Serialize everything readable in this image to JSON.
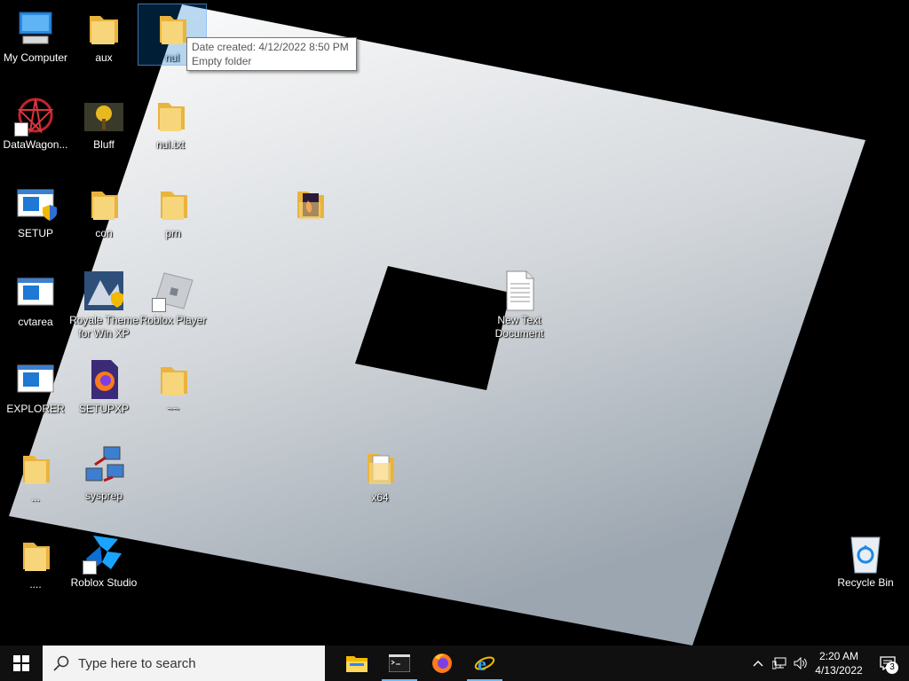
{
  "desktop": {
    "icons": [
      {
        "label": "My Computer"
      },
      {
        "label": "aux"
      },
      {
        "label": "nul"
      },
      {
        "label": "DataWagon..."
      },
      {
        "label": "Bluff"
      },
      {
        "label": "nul.txt"
      },
      {
        "label": "SETUP"
      },
      {
        "label": "con"
      },
      {
        "label": "prn"
      },
      {
        "label": "cvtarea"
      },
      {
        "label": "Royale Theme for Win XP"
      },
      {
        "label": "Roblox Player"
      },
      {
        "label": "New Text Document"
      },
      {
        "label": "EXPLORER"
      },
      {
        "label": "SETUPXP"
      },
      {
        "label": "~~"
      },
      {
        "label": "..."
      },
      {
        "label": "sysprep"
      },
      {
        "label": "x64"
      },
      {
        "label": "...."
      },
      {
        "label": "Roblox Studio"
      },
      {
        "label": "Recycle Bin"
      }
    ],
    "tooltip": {
      "line1": "Date created: 4/12/2022 8:50 PM",
      "line2": "Empty folder"
    }
  },
  "taskbar": {
    "search_placeholder": "Type here to search",
    "clock_time": "2:20 AM",
    "clock_date": "4/13/2022",
    "notification_count": "3"
  },
  "colors": {
    "taskbar": "#101010",
    "accent": "#0078d7",
    "folder": "#f5c451"
  }
}
